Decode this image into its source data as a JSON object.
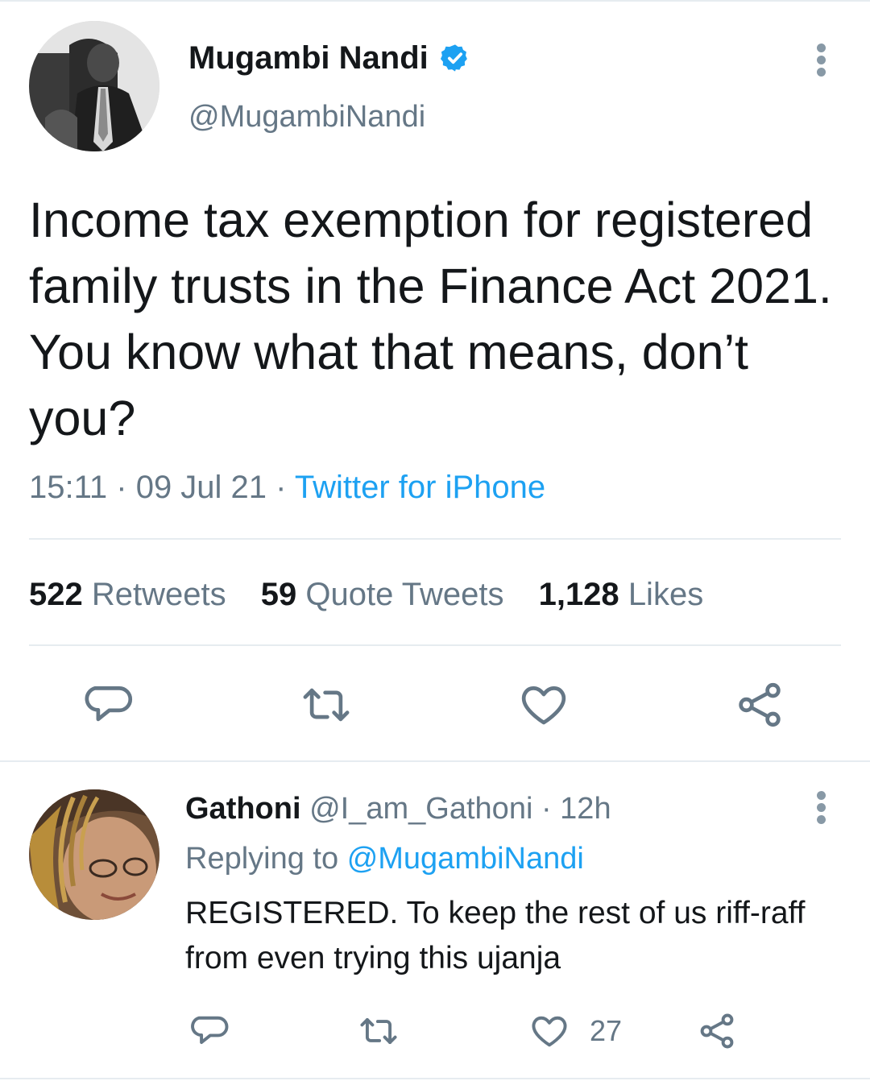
{
  "tweet": {
    "author_name": "Mugambi Nandi",
    "author_handle": "@MugambiNandi",
    "text": "Income tax exemption for registered family trusts in the Finance Act 2021. You know what that means, don’t you?",
    "time": "15:11",
    "date": "09 Jul 21",
    "source": "Twitter for iPhone",
    "stats": {
      "retweets_count": "522",
      "retweets_label": "Retweets",
      "quotes_count": "59",
      "quotes_label": "Quote Tweets",
      "likes_count": "1,128",
      "likes_label": "Likes"
    }
  },
  "reply": {
    "author_name": "Gathoni",
    "author_handle": "@I_am_Gathoni",
    "time_ago": "12h",
    "replying_label": "Replying to",
    "replying_to": "@MugambiNandi",
    "text": "REGISTERED. To keep the rest of us riff-raff from even trying this ujanja",
    "like_count": "27"
  },
  "colors": {
    "accent": "#1da1f2",
    "secondary_text": "#657786",
    "primary_text": "#14171a",
    "icon": "#657786",
    "divider": "#e6ecf0"
  },
  "icons": [
    "verified-badge-icon",
    "more-options-icon",
    "reply-icon",
    "retweet-icon",
    "like-icon",
    "share-icon"
  ]
}
